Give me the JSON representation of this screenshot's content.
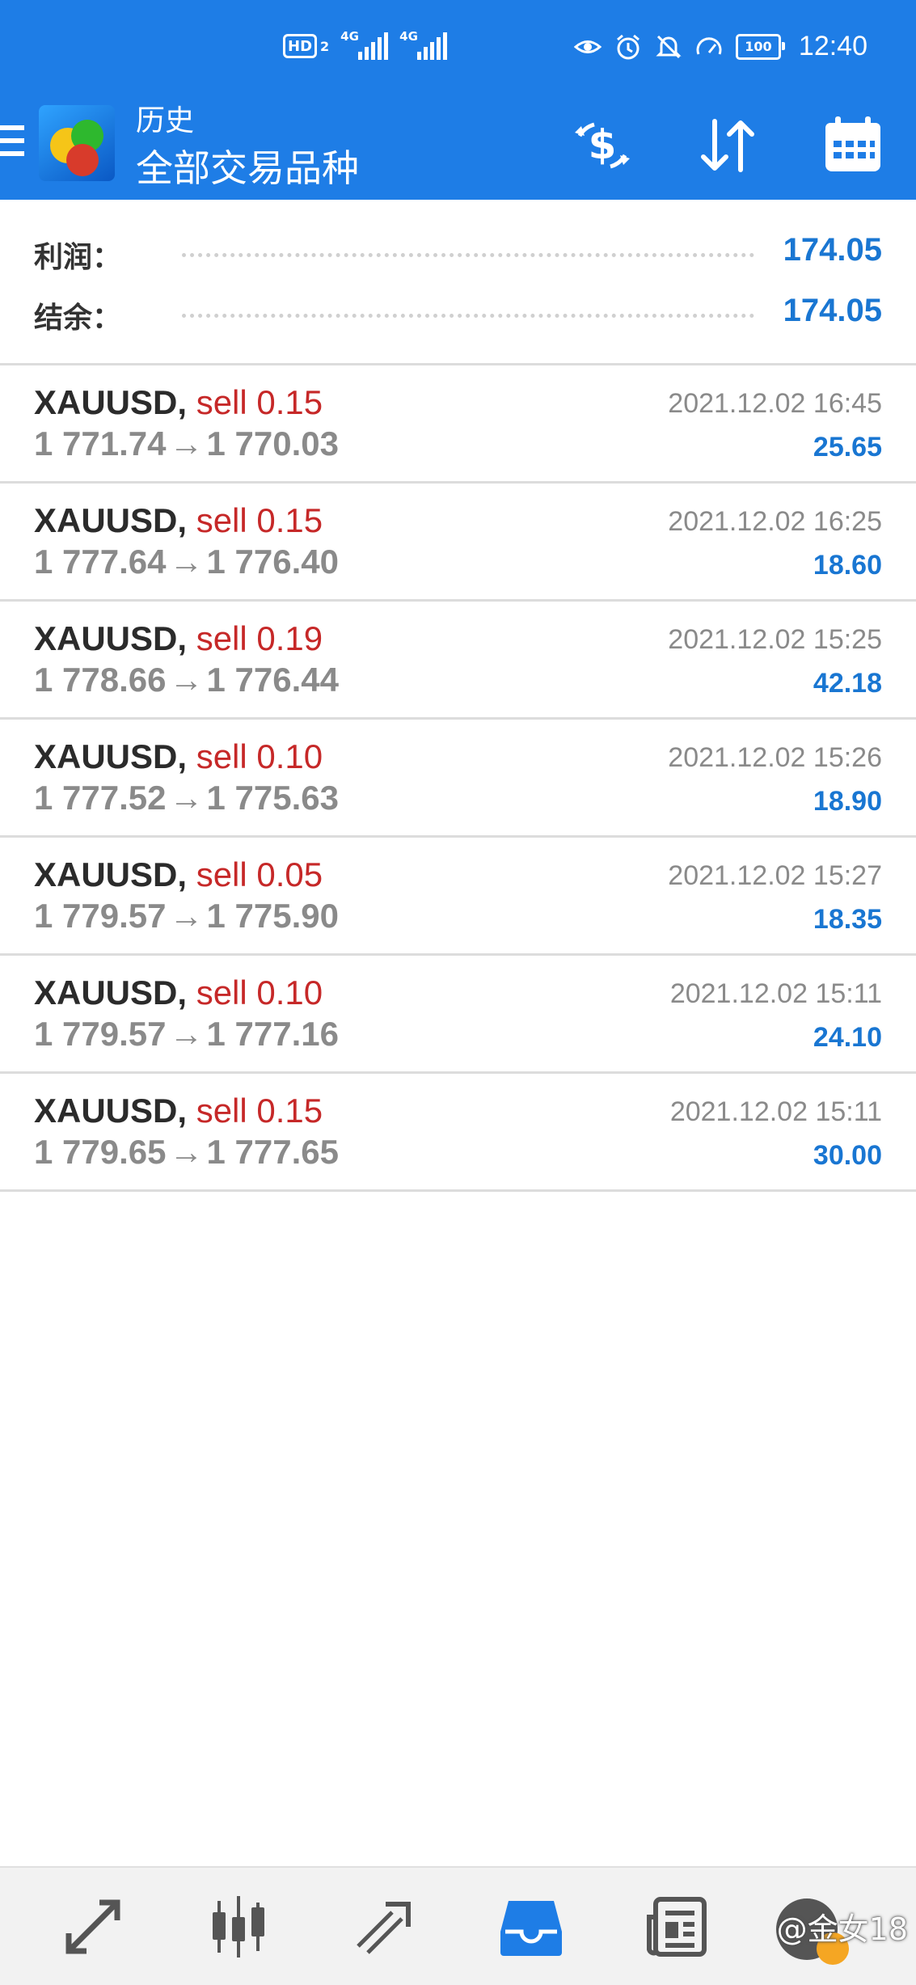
{
  "status_bar": {
    "hd_label": "HD",
    "hd_sub": "2",
    "signal1_label": "4G",
    "signal2_label": "4G",
    "battery": "100",
    "time": "12:40"
  },
  "header": {
    "subtitle": "历史",
    "title": "全部交易品种",
    "icons": [
      "menu-icon",
      "app-logo",
      "currency-exchange-icon",
      "sort-icon",
      "calendar-icon"
    ]
  },
  "summary": {
    "profit_label": "利润：",
    "profit_value": "174.05",
    "balance_label": "结余：",
    "balance_value": "174.05"
  },
  "deals": [
    {
      "symbol": "XAUUSD,",
      "side": "sell 0.15",
      "open": "1 771.74",
      "close": "1 770.03",
      "time": "2021.12.02 16:45",
      "profit": "25.65"
    },
    {
      "symbol": "XAUUSD,",
      "side": "sell 0.15",
      "open": "1 777.64",
      "close": "1 776.40",
      "time": "2021.12.02 16:25",
      "profit": "18.60"
    },
    {
      "symbol": "XAUUSD,",
      "side": "sell 0.19",
      "open": "1 778.66",
      "close": "1 776.44",
      "time": "2021.12.02 15:25",
      "profit": "42.18"
    },
    {
      "symbol": "XAUUSD,",
      "side": "sell 0.10",
      "open": "1 777.52",
      "close": "1 775.63",
      "time": "2021.12.02 15:26",
      "profit": "18.90"
    },
    {
      "symbol": "XAUUSD,",
      "side": "sell 0.05",
      "open": "1 779.57",
      "close": "1 775.90",
      "time": "2021.12.02 15:27",
      "profit": "18.35"
    },
    {
      "symbol": "XAUUSD,",
      "side": "sell 0.10",
      "open": "1 779.57",
      "close": "1 777.16",
      "time": "2021.12.02 15:11",
      "profit": "24.10"
    },
    {
      "symbol": "XAUUSD,",
      "side": "sell 0.15",
      "open": "1 779.65",
      "close": "1 777.65",
      "time": "2021.12.02 15:11",
      "profit": "30.00"
    }
  ],
  "arrow_glyph": "→",
  "bottom_nav": {
    "items": [
      "quotes-icon",
      "chart-icon",
      "trade-icon",
      "history-icon",
      "news-icon"
    ],
    "active": "history-icon",
    "accent": "#1e7de6",
    "watermark": "@金女18"
  },
  "colors": {
    "header_bg": "#1e7de6",
    "profit_blue": "#1976d2",
    "sell_red": "#c62828",
    "price_gray": "#8a8a8a"
  }
}
